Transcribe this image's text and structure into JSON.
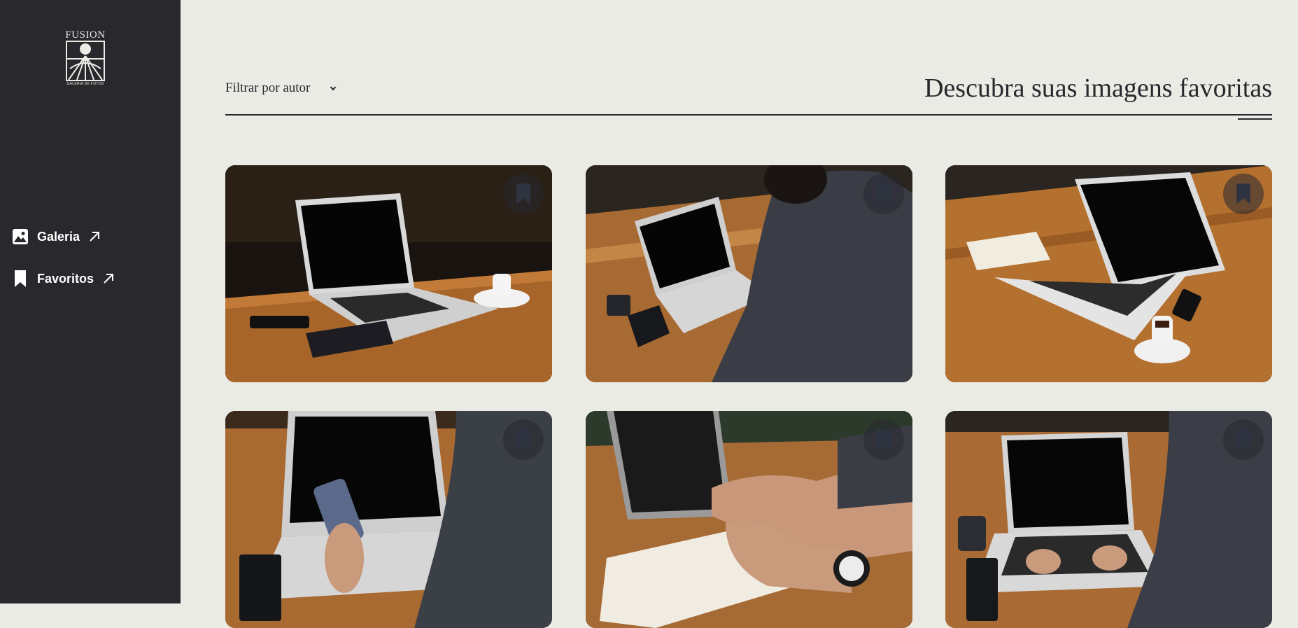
{
  "brand": {
    "name": "FUSION",
    "subtitle": "GALERIA DE FOTOS"
  },
  "sidebar": {
    "items": [
      {
        "label": "Galeria",
        "icon": "image-icon"
      },
      {
        "label": "Favoritos",
        "icon": "bookmark-icon"
      }
    ]
  },
  "filter": {
    "label": "Filtrar por autor"
  },
  "page": {
    "title": "Descubra suas imagens favoritas"
  },
  "gallery": {
    "images": [
      {
        "subject": "laptop-on-wooden-table",
        "favorited": false
      },
      {
        "subject": "man-typing-on-laptop",
        "favorited": false
      },
      {
        "subject": "laptop-notebook-coffee",
        "favorited": false
      },
      {
        "subject": "hand-holding-phone-over-laptop",
        "favorited": false
      },
      {
        "subject": "man-writing-in-notebook",
        "favorited": false
      },
      {
        "subject": "man-typing-on-laptop-closeup",
        "favorited": false
      }
    ]
  },
  "colors": {
    "sidebar": "#28282d",
    "background": "#ebebe6",
    "text": "#28282d",
    "wood": "#b06a2c"
  }
}
